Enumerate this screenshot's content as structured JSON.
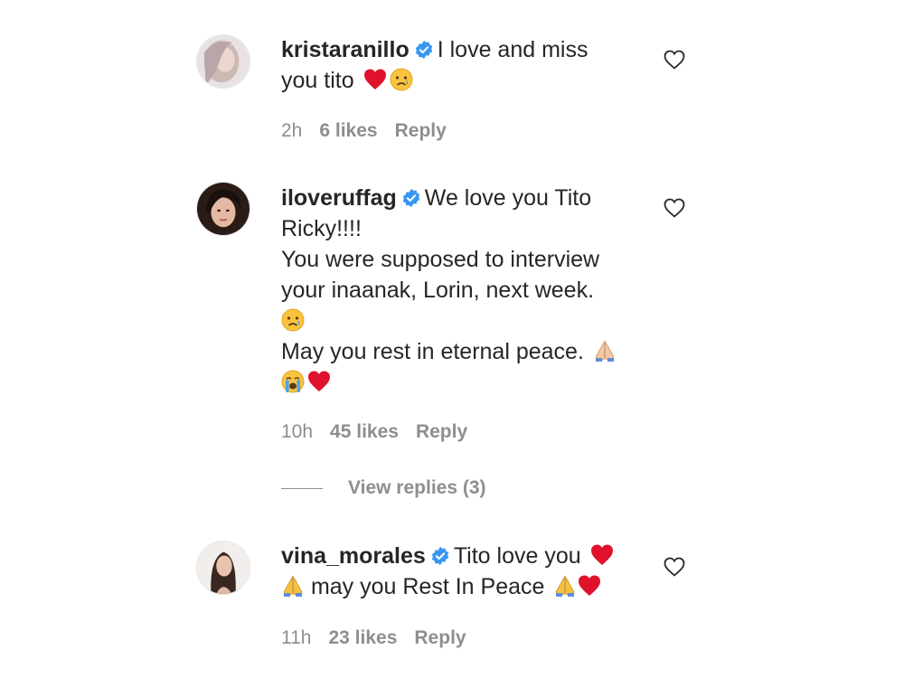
{
  "comments": [
    {
      "username": "kristaranillo",
      "lines": [
        "I love and miss",
        "you tito"
      ],
      "time": "2h",
      "likes": "6 likes",
      "reply": "Reply"
    },
    {
      "username": "iloveruffag",
      "lines": [
        "We love you Tito",
        "Ricky!!!!",
        "You were supposed to interview",
        "your inaanak, Lorin, next week.",
        "May you rest in eternal peace."
      ],
      "time": "10h",
      "likes": "45 likes",
      "reply": "Reply",
      "view_replies": "View replies (3)"
    },
    {
      "username": "vina_morales",
      "lines": [
        "Tito love you",
        "may you Rest In Peace"
      ],
      "time": "11h",
      "likes": "23 likes",
      "reply": "Reply"
    }
  ],
  "colors": {
    "text": "#262626",
    "muted": "#8e8e8e",
    "verified": "#3897f0",
    "heart_emoji": "#e0112b"
  },
  "icons": {
    "like": "heart-outline-icon",
    "verified": "verified-badge-icon",
    "emojis": [
      "red-heart-emoji",
      "crying-face-emoji",
      "folded-hands-emoji",
      "loudly-crying-face-emoji"
    ]
  }
}
